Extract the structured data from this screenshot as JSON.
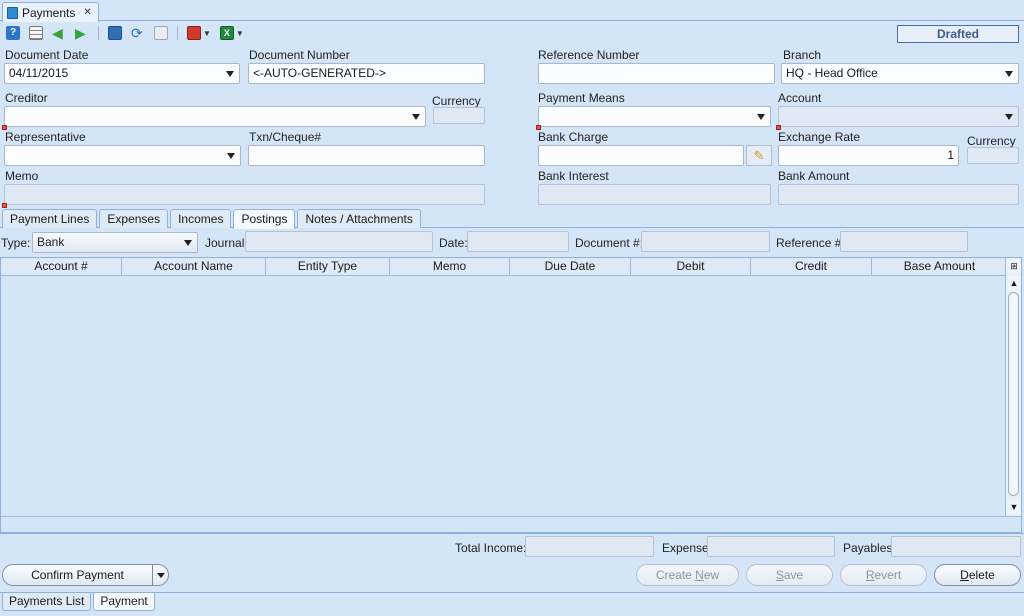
{
  "window": {
    "title": "Payments"
  },
  "toolbar": {
    "icons": [
      "help-icon",
      "grid-icon",
      "back-arrow-icon",
      "forward-arrow-icon",
      "save-disk-icon",
      "refresh-icon",
      "copy-icon",
      "pdf-export-icon",
      "excel-export-icon"
    ]
  },
  "status": "Drafted",
  "form": {
    "document_date": {
      "label": "Document Date",
      "value": "04/11/2015"
    },
    "document_number": {
      "label": "Document Number",
      "value": "<-AUTO-GENERATED->"
    },
    "reference_number": {
      "label": "Reference Number",
      "value": ""
    },
    "branch": {
      "label": "Branch",
      "value": "HQ - Head Office"
    },
    "creditor": {
      "label": "Creditor",
      "value": ""
    },
    "currency": {
      "label": "Currency",
      "value": ""
    },
    "payment_means": {
      "label": "Payment Means",
      "value": ""
    },
    "account": {
      "label": "Account",
      "value": ""
    },
    "representative": {
      "label": "Representative",
      "value": ""
    },
    "txn_cheque": {
      "label": "Txn/Cheque#",
      "value": ""
    },
    "bank_charge": {
      "label": "Bank Charge",
      "value": ""
    },
    "exchange_rate": {
      "label": "Exchange Rate",
      "value": "1"
    },
    "currency2": {
      "label": "Currency",
      "value": ""
    },
    "memo": {
      "label": "Memo",
      "value": ""
    },
    "bank_interest": {
      "label": "Bank Interest",
      "value": ""
    },
    "bank_amount": {
      "label": "Bank Amount",
      "value": ""
    }
  },
  "tabs": [
    "Payment Lines",
    "Expenses",
    "Incomes",
    "Postings",
    "Notes / Attachments"
  ],
  "active_tab": "Postings",
  "filters": {
    "type_label": "Type:",
    "type_value": "Bank",
    "journal_label": "Journal:",
    "date_label": "Date:",
    "document_label": "Document #:",
    "reference_label": "Reference #:"
  },
  "grid": {
    "columns": [
      "Account #",
      "Account Name",
      "Entity Type",
      "Memo",
      "Due Date",
      "Debit",
      "Credit",
      "Base Amount"
    ]
  },
  "totals": {
    "income_label": "Total Income:",
    "expense_label": "Expense:",
    "payables_label": "Payables:"
  },
  "buttons": {
    "confirm": "Confirm Payment",
    "create_new_pre": "Create ",
    "create_new_u": "N",
    "create_new_post": "ew",
    "save_u": "S",
    "save_post": "ave",
    "revert_u": "R",
    "revert_post": "evert",
    "delete_u": "D",
    "delete_post": "elete"
  },
  "bottom_tabs": [
    "Payments List",
    "Payment"
  ],
  "colors": {
    "background": "#d4e5f8",
    "status_text": "#3f5c8c",
    "required_marker": "#e85050"
  }
}
